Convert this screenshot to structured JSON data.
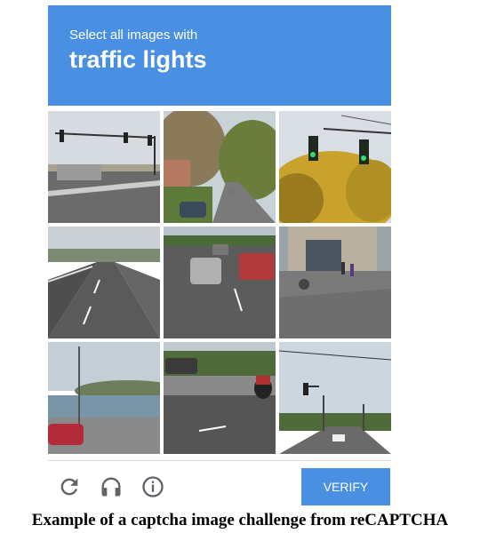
{
  "challenge": {
    "instruction_prefix": "Select all images with",
    "target_object": "traffic lights"
  },
  "tiles": [
    {
      "scene": "intersection with overhead traffic lights on a mast arm"
    },
    {
      "scene": "tree-lined residential street with parked cars"
    },
    {
      "scene": "traffic lights hanging above autumn trees"
    },
    {
      "scene": "empty multi-lane highway"
    },
    {
      "scene": "busy road with cars in traffic"
    },
    {
      "scene": "city sidewalk with pedestrians and storefronts"
    },
    {
      "scene": "waterfront with bay and red car"
    },
    {
      "scene": "road with motorcyclist and barrier"
    },
    {
      "scene": "road with traffic light and street lamps"
    }
  ],
  "footer": {
    "reload_icon": "reload-icon",
    "audio_icon": "headphones-icon",
    "info_icon": "info-icon",
    "verify_label": "VERIFY"
  },
  "caption": "Example of a captcha image challenge from reCAPTCHA",
  "colors": {
    "accent": "#4a90e2",
    "icon_gray": "#5f6368"
  }
}
